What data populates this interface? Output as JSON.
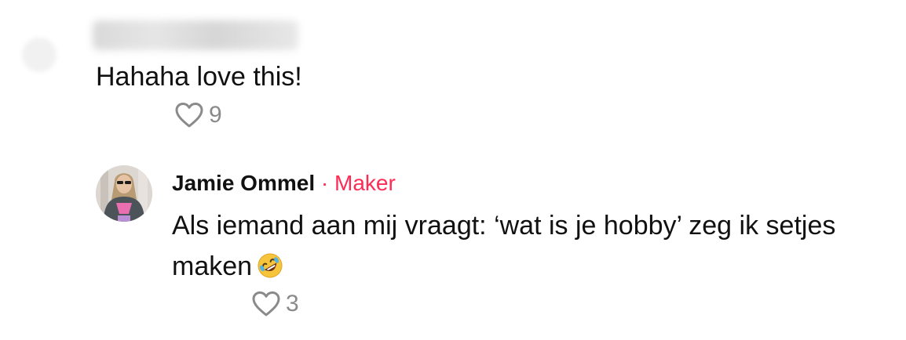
{
  "comments": [
    {
      "username": "",
      "username_blurred": true,
      "text": "Hahaha love this!",
      "likes": "9"
    },
    {
      "username": "Jamie Ommel",
      "separator": "·",
      "badge": "Maker",
      "text": "Als iemand aan mij vraagt: ‘wat is je hobby’ zeg ik setjes maken",
      "emoji": "rolling-on-floor-laughing",
      "likes": "3"
    }
  ],
  "colors": {
    "badge": "#fe2c55",
    "like_icon": "#8a8a8a",
    "text": "#111111"
  },
  "icons": {
    "like": "heart-outline-icon"
  }
}
